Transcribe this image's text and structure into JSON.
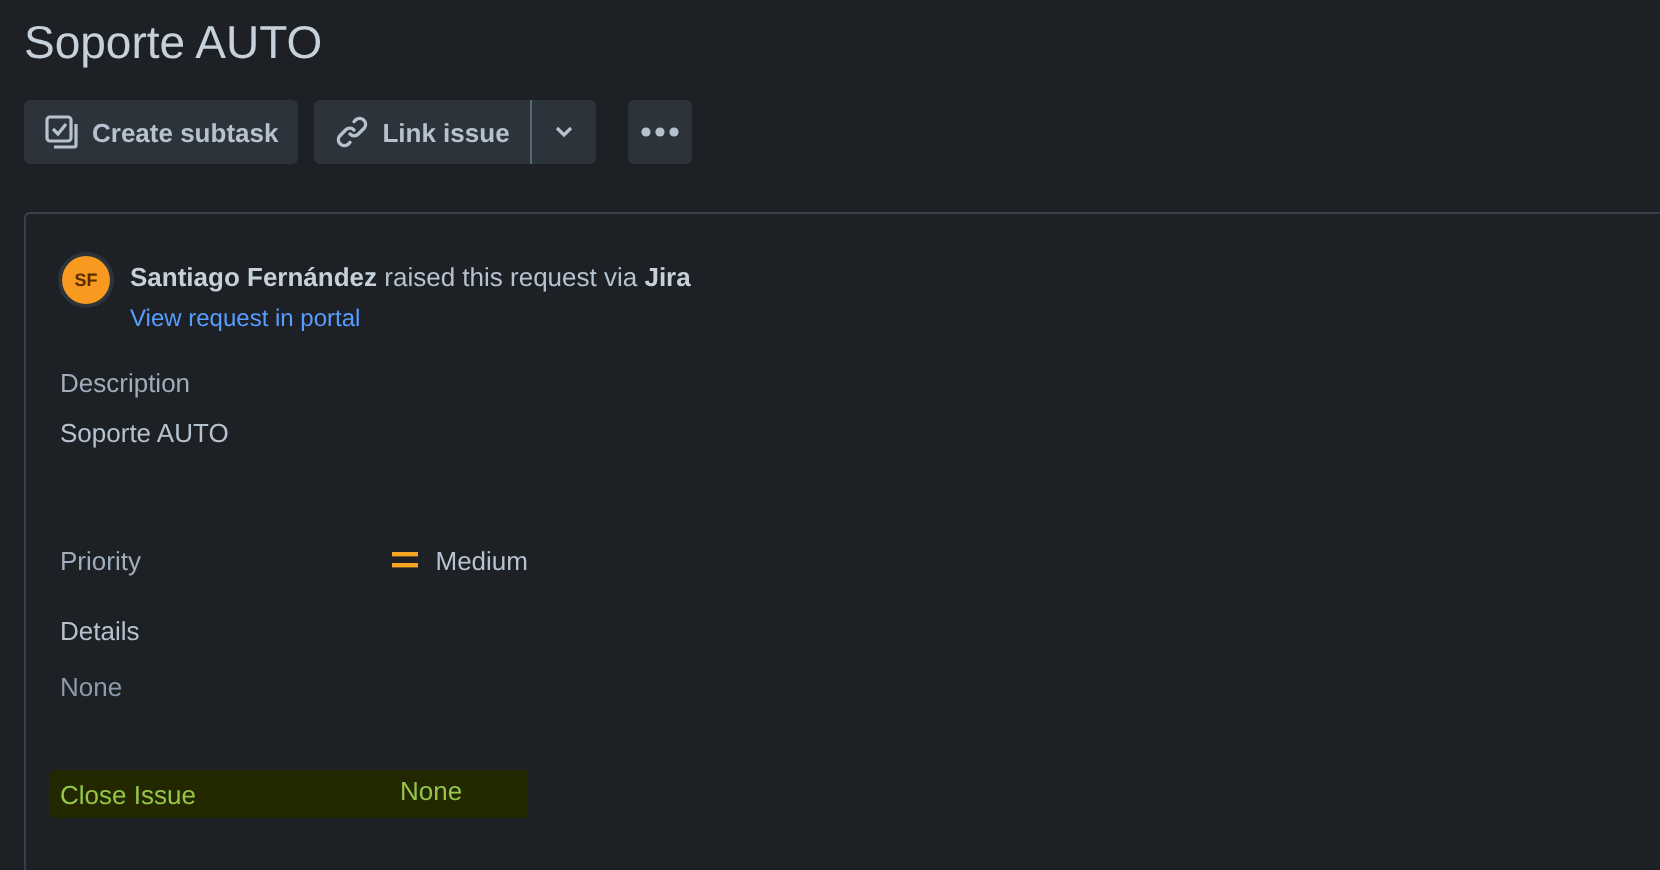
{
  "title": "Soporte AUTO",
  "toolbar": [
    {
      "kind": "subtask",
      "label": "Create subtask"
    },
    {
      "kind": "link",
      "label": "Link issue"
    },
    {
      "kind": "more"
    }
  ],
  "request": {
    "avatar": "SF",
    "text": "**Santiago Fernández** raised this request via **Jira**",
    "link": "View request in portal"
  },
  "description": {
    "label": "Description",
    "value": "Soporte AUTO"
  },
  "priority": {
    "label": "Priority",
    "value": "Medium"
  },
  "details": {
    "label": "Details",
    "value": "None"
  },
  "close_issue": {
    "label": "Close Issue",
    "value": "None",
    "highlighted": true
  }
}
